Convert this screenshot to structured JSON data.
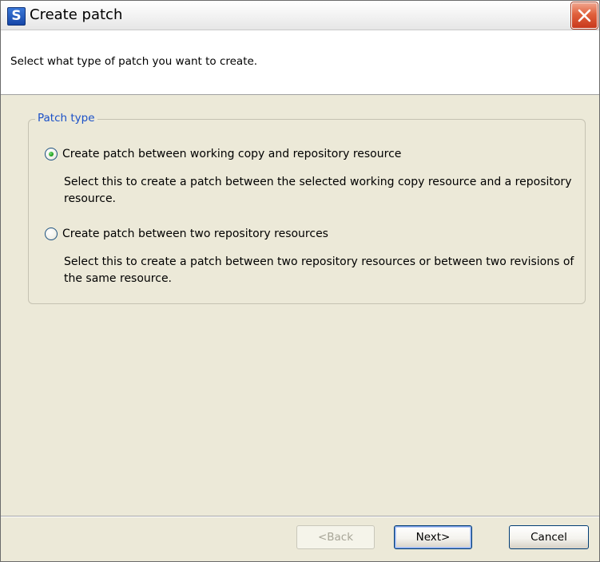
{
  "window": {
    "title": "Create patch",
    "app_icon_letter": "S"
  },
  "banner": {
    "message": "Select what type of patch you want to create."
  },
  "group": {
    "legend": "Patch type",
    "options": [
      {
        "label": "Create patch between working copy and repository resource",
        "description": "Select this to create a patch between the selected working copy resource and a repository resource.",
        "checked": true
      },
      {
        "label": "Create patch between two repository resources",
        "description": "Select this to create a patch between two repository resources or between two revisions of the same resource.",
        "checked": false
      }
    ]
  },
  "buttons": {
    "back": "<Back",
    "next": "Next>",
    "cancel": "Cancel"
  },
  "colors": {
    "accent": "#1a50c8",
    "close": "#e0603c",
    "dialog_bg": "#ece9d8"
  }
}
